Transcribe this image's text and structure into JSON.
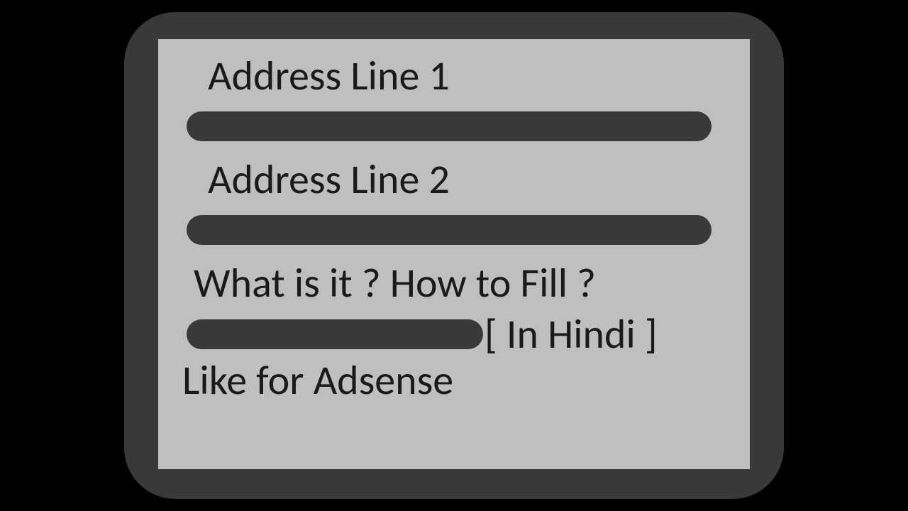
{
  "form": {
    "address1_label": "Address Line 1",
    "address2_label": "Address Line 2",
    "question_text": "What is it ? How to Fill ?",
    "in_hindi_text": "[ In Hindi ]",
    "like_adsense_text": "Like for Adsense"
  }
}
